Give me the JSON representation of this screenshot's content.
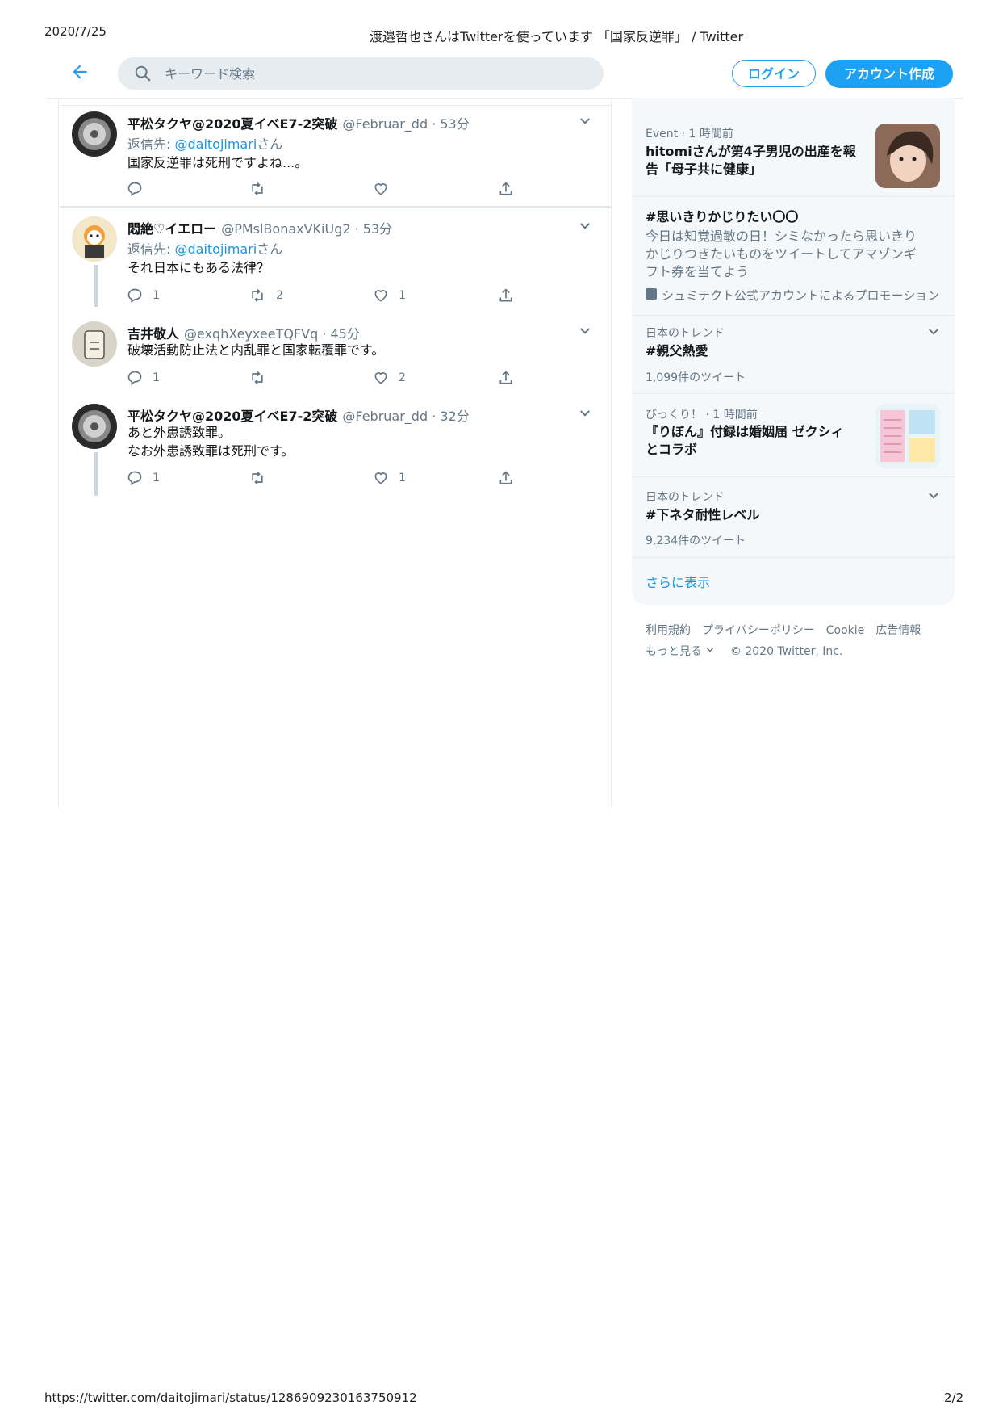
{
  "print": {
    "date": "2020/7/25",
    "title": "渡邉哲也さんはTwitterを使っています 「国家反逆罪」 / Twitter",
    "url": "https://twitter.com/daitojimari/status/1286909230163750912",
    "page": "2/2"
  },
  "header": {
    "search_placeholder": "キーワード検索",
    "login_label": "ログイン",
    "signup_label": "アカウント作成"
  },
  "tweets": [
    {
      "name": "平松タクヤ@2020夏イベE7-2突破",
      "meta": "@Februar_dd · 53分",
      "reply_prefix": "返信先: ",
      "reply_mention": "@daitojimari",
      "reply_suffix": "さん",
      "text": "国家反逆罪は死刑ですよね...。",
      "reply_count": "",
      "retweet_count": "",
      "like_count": ""
    },
    {
      "name": "悶絶♡イエロー",
      "meta": "@PMslBonaxVKiUg2 · 53分",
      "reply_prefix": "返信先: ",
      "reply_mention": "@daitojimari",
      "reply_suffix": "さん",
      "text": "それ日本にもある法律？",
      "reply_count": "1",
      "retweet_count": "2",
      "like_count": "1"
    },
    {
      "name": "吉井敬人",
      "meta": "@exqhXeyxeeTQFVq · 45分",
      "text": "破壊活動防止法と内乱罪と国家転覆罪です。",
      "reply_count": "1",
      "retweet_count": "",
      "like_count": "2"
    },
    {
      "name": "平松タクヤ@2020夏イベE7-2突破",
      "meta": "@Februar_dd · 32分",
      "text_line1": "あと外患誘致罪。",
      "text_line2": "なお外患誘致罪は死刑です。",
      "reply_count": "1",
      "retweet_count": "",
      "like_count": "1"
    }
  ],
  "sidebar": {
    "trends": [
      {
        "context": "Event · 1 時間前",
        "title_line1": "hitomiさんが第4子男児の出産を報",
        "title_line2": "告「母子共に健康」"
      },
      {
        "title": "#思いきりかじりたい〇〇",
        "body_line1": "今日は知覚過敏の日！シミなかったら思いきり",
        "body_line2": "かじりつきたいものをツイートしてアマゾンギ",
        "body_line3": "フト券を当てよう",
        "promo": "シュミテクト公式アカウントによるプロモーション"
      },
      {
        "context": "日本のトレンド",
        "title": "#親父熱愛",
        "count": "1,099件のツイート"
      },
      {
        "context": "びっくり！ · 1 時間前",
        "title_line1": "『りぼん』付録は婚姻届 ゼクシィ",
        "title_line2": "とコラボ"
      },
      {
        "context": "日本のトレンド",
        "title": "#下ネタ耐性レベル",
        "count": "9,234件のツイート"
      }
    ],
    "show_more": "さらに表示"
  },
  "footer": {
    "links": [
      "利用規約",
      "プライバシーポリシー",
      "Cookie",
      "広告情報"
    ],
    "more": "もっと見る",
    "copyright": "© 2020 Twitter, Inc."
  },
  "colors": {
    "accent": "#1da1f2",
    "link": "#1b95e0",
    "secondary_text": "#657786",
    "panel_bg": "#f5f8fa"
  }
}
